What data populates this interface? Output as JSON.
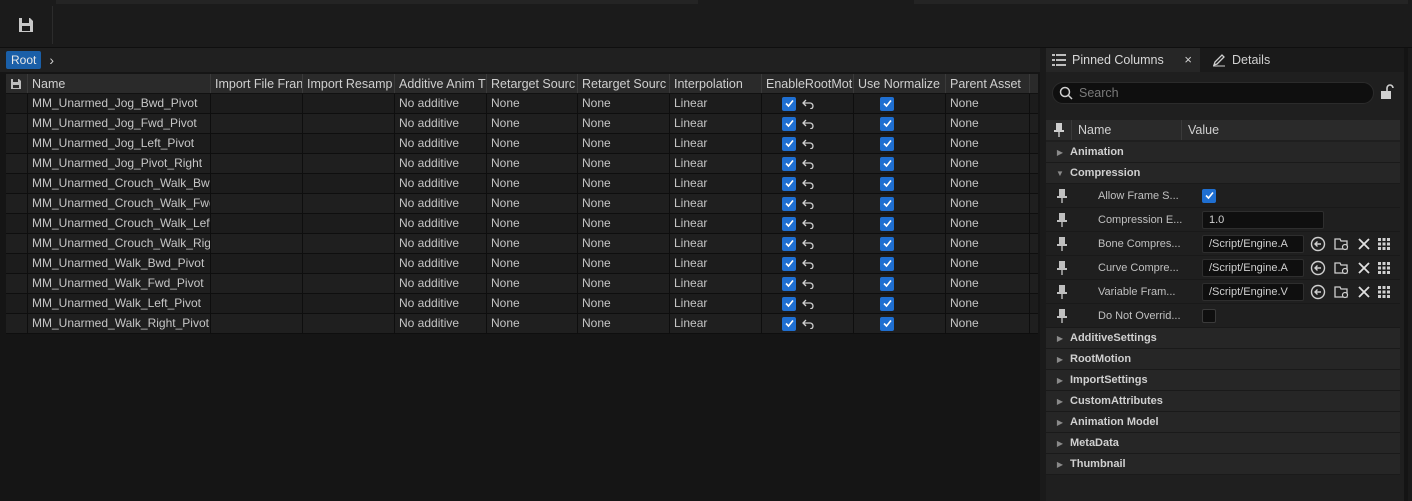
{
  "toolbar": {
    "save_icon": "save-icon"
  },
  "breadcrumb": {
    "root": "Root",
    "chevron": "›"
  },
  "grid": {
    "columns": [
      "Name",
      "Import File Fran",
      "Import Resamp",
      "Additive Anim T",
      "Retarget Sourc",
      "Retarget Sourc",
      "Interpolation",
      "EnableRootMot",
      "Use Normalize",
      "Parent Asset"
    ],
    "rows": [
      {
        "name": "MM_Unarmed_Jog_Bwd_Pivot",
        "additive": "No additive",
        "retarget1": "None",
        "retarget2": "None",
        "interp": "Linear",
        "parent": "None"
      },
      {
        "name": "MM_Unarmed_Jog_Fwd_Pivot",
        "additive": "No additive",
        "retarget1": "None",
        "retarget2": "None",
        "interp": "Linear",
        "parent": "None"
      },
      {
        "name": "MM_Unarmed_Jog_Left_Pivot",
        "additive": "No additive",
        "retarget1": "None",
        "retarget2": "None",
        "interp": "Linear",
        "parent": "None"
      },
      {
        "name": "MM_Unarmed_Jog_Pivot_Right",
        "additive": "No additive",
        "retarget1": "None",
        "retarget2": "None",
        "interp": "Linear",
        "parent": "None"
      },
      {
        "name": "MM_Unarmed_Crouch_Walk_Bwd_",
        "additive": "No additive",
        "retarget1": "None",
        "retarget2": "None",
        "interp": "Linear",
        "parent": "None"
      },
      {
        "name": "MM_Unarmed_Crouch_Walk_Fwd_",
        "additive": "No additive",
        "retarget1": "None",
        "retarget2": "None",
        "interp": "Linear",
        "parent": "None"
      },
      {
        "name": "MM_Unarmed_Crouch_Walk_Left_",
        "additive": "No additive",
        "retarget1": "None",
        "retarget2": "None",
        "interp": "Linear",
        "parent": "None"
      },
      {
        "name": "MM_Unarmed_Crouch_Walk_Righ",
        "additive": "No additive",
        "retarget1": "None",
        "retarget2": "None",
        "interp": "Linear",
        "parent": "None"
      },
      {
        "name": "MM_Unarmed_Walk_Bwd_Pivot",
        "additive": "No additive",
        "retarget1": "None",
        "retarget2": "None",
        "interp": "Linear",
        "parent": "None"
      },
      {
        "name": "MM_Unarmed_Walk_Fwd_Pivot",
        "additive": "No additive",
        "retarget1": "None",
        "retarget2": "None",
        "interp": "Linear",
        "parent": "None"
      },
      {
        "name": "MM_Unarmed_Walk_Left_Pivot",
        "additive": "No additive",
        "retarget1": "None",
        "retarget2": "None",
        "interp": "Linear",
        "parent": "None"
      },
      {
        "name": "MM_Unarmed_Walk_Right_Pivot",
        "additive": "No additive",
        "retarget1": "None",
        "retarget2": "None",
        "interp": "Linear",
        "parent": "None"
      }
    ]
  },
  "right_panel": {
    "tabs": {
      "pinned": "Pinned Columns",
      "close": "×",
      "details": "Details"
    },
    "search_placeholder": "Search",
    "columns": {
      "name": "Name",
      "value": "Value"
    },
    "categories": {
      "animation": "Animation",
      "compression": "Compression",
      "additive": "AdditiveSettings",
      "rootmotion": "RootMotion",
      "import": "ImportSettings",
      "custom": "CustomAttributes",
      "model": "Animation Model",
      "meta": "MetaData",
      "thumb": "Thumbnail"
    },
    "props": {
      "allow_frame": {
        "label": "Allow Frame S..."
      },
      "comp_error": {
        "label": "Compression E...",
        "value": "1.0"
      },
      "bone_comp": {
        "label": "Bone Compres...",
        "value": "/Script/Engine.A"
      },
      "curve_comp": {
        "label": "Curve Compre...",
        "value": "/Script/Engine.A"
      },
      "variable_frame": {
        "label": "Variable Fram...",
        "value": "/Script/Engine.V"
      },
      "do_not_override": {
        "label": "Do Not Overrid..."
      }
    }
  },
  "colors": {
    "accent": "#1f6fd1",
    "annotation": "#cc2222"
  }
}
